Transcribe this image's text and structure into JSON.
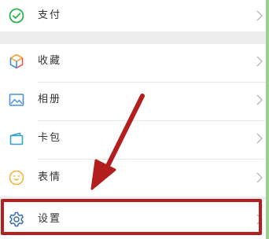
{
  "menu": {
    "items": [
      {
        "id": "pay",
        "label": "支付",
        "icon": "wechat-pay-icon"
      },
      {
        "id": "favorites",
        "label": "收藏",
        "icon": "cube-icon"
      },
      {
        "id": "album",
        "label": "相册",
        "icon": "picture-icon"
      },
      {
        "id": "cards",
        "label": "卡包",
        "icon": "wallet-icon"
      },
      {
        "id": "stickers",
        "label": "表情",
        "icon": "smiley-icon"
      },
      {
        "id": "settings",
        "label": "设置",
        "icon": "gear-icon"
      }
    ]
  },
  "annotation": {
    "color": "#b31f1f",
    "target": "settings",
    "arrow_icon": "red-arrow-annotation"
  },
  "colors": {
    "pay_green": "#2bb24c",
    "favorites_orange": "#f2a33a",
    "favorites_blue": "#3f8fe0",
    "album_blue": "#4a90d9",
    "cards_teal": "#2f9fd0",
    "stickers_yellow": "#f3b33d",
    "settings_blue": "#3a6fb0"
  }
}
